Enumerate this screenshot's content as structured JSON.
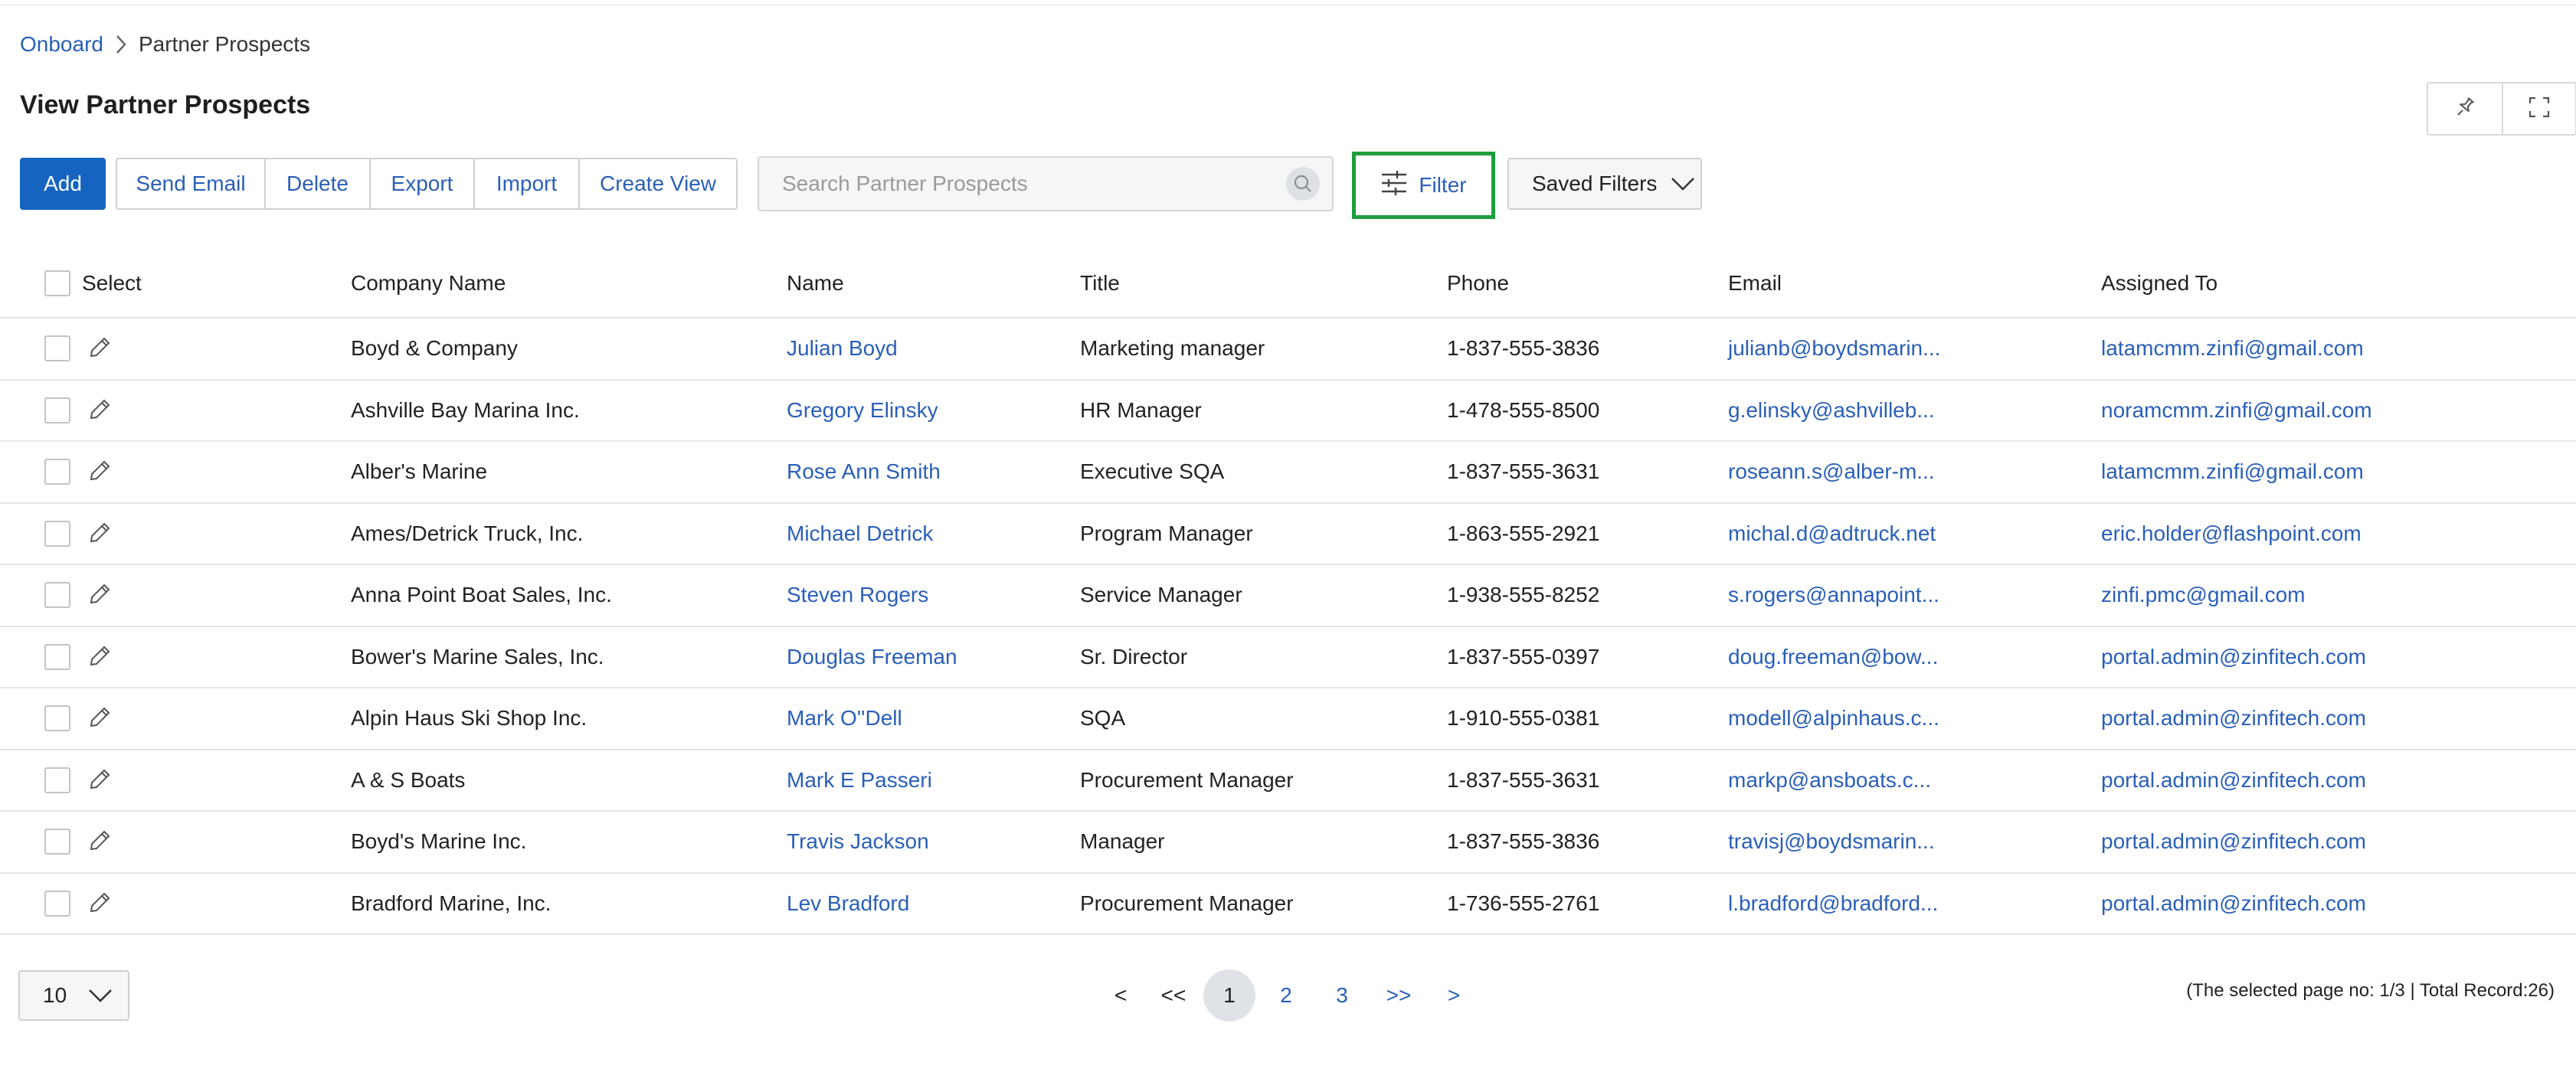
{
  "breadcrumb": {
    "root": "Onboard",
    "current": "Partner Prospects"
  },
  "page_title": "View Partner Prospects",
  "toolbar": {
    "add_label": "Add",
    "buttons": [
      "Send Email",
      "Delete",
      "Export",
      "Import",
      "Create View"
    ],
    "search_placeholder": "Search Partner Prospects",
    "filter_label": "Filter",
    "saved_filters_label": "Saved Filters"
  },
  "table": {
    "headers": {
      "select": "Select",
      "company": "Company Name",
      "name": "Name",
      "title": "Title",
      "phone": "Phone",
      "email": "Email",
      "assigned": "Assigned To"
    },
    "rows": [
      {
        "company": "Boyd & Company",
        "name": "Julian Boyd",
        "title": "Marketing manager",
        "phone": "1-837-555-3836",
        "email": "julianb@boydsmarin...",
        "assigned": "latamcmm.zinfi@gmail.com"
      },
      {
        "company": "Ashville Bay Marina Inc.",
        "name": "Gregory Elinsky",
        "title": "HR Manager",
        "phone": "1-478-555-8500",
        "email": "g.elinsky@ashvilleb...",
        "assigned": "noramcmm.zinfi@gmail.com"
      },
      {
        "company": "Alber's Marine",
        "name": "Rose Ann Smith",
        "title": "Executive SQA",
        "phone": "1-837-555-3631",
        "email": "roseann.s@alber-m...",
        "assigned": "latamcmm.zinfi@gmail.com"
      },
      {
        "company": "Ames/Detrick Truck, Inc.",
        "name": "Michael Detrick",
        "title": "Program Manager",
        "phone": "1-863-555-2921",
        "email": "michal.d@adtruck.net",
        "assigned": "eric.holder@flashpoint.com"
      },
      {
        "company": "Anna Point Boat Sales, Inc.",
        "name": "Steven Rogers",
        "title": "Service Manager",
        "phone": "1-938-555-8252",
        "email": "s.rogers@annapoint...",
        "assigned": "zinfi.pmc@gmail.com"
      },
      {
        "company": "Bower's Marine Sales, Inc.",
        "name": "Douglas Freeman",
        "title": "Sr. Director",
        "phone": "1-837-555-0397",
        "email": "doug.freeman@bow...",
        "assigned": "portal.admin@zinfitech.com"
      },
      {
        "company": "Alpin Haus Ski Shop Inc.",
        "name": "Mark O''Dell",
        "title": "SQA",
        "phone": "1-910-555-0381",
        "email": "modell@alpinhaus.c...",
        "assigned": "portal.admin@zinfitech.com"
      },
      {
        "company": "A & S Boats",
        "name": "Mark E Passeri",
        "title": "Procurement Manager",
        "phone": "1-837-555-3631",
        "email": "markp@ansboats.c...",
        "assigned": "portal.admin@zinfitech.com"
      },
      {
        "company": "Boyd's Marine Inc.",
        "name": "Travis Jackson",
        "title": "Manager",
        "phone": "1-837-555-3836",
        "email": "travisj@boydsmarin...",
        "assigned": "portal.admin@zinfitech.com"
      },
      {
        "company": "Bradford Marine, Inc.",
        "name": "Lev Bradford",
        "title": "Procurement Manager",
        "phone": "1-736-555-2761",
        "email": "l.bradford@bradford...",
        "assigned": "portal.admin@zinfitech.com"
      }
    ]
  },
  "pagination": {
    "page_size": "10",
    "prev": "<",
    "first": "<<",
    "pages": [
      "1",
      "2",
      "3"
    ],
    "current_page": "1",
    "last": ">>",
    "next": ">",
    "info": "(The selected page no: 1/3 | Total Record:26)"
  },
  "icons": {
    "pin": "pin-icon",
    "fullscreen": "fullscreen-icon",
    "search": "search-icon",
    "filter": "sliders-icon",
    "dropdown": "chevron-down-icon",
    "edit": "pencil-icon",
    "breadcrumb_separator": "chevron-right-icon"
  },
  "colors": {
    "primary": "#1565c0",
    "link": "#2a5fb8",
    "filter_highlight": "#1e9e3e"
  }
}
